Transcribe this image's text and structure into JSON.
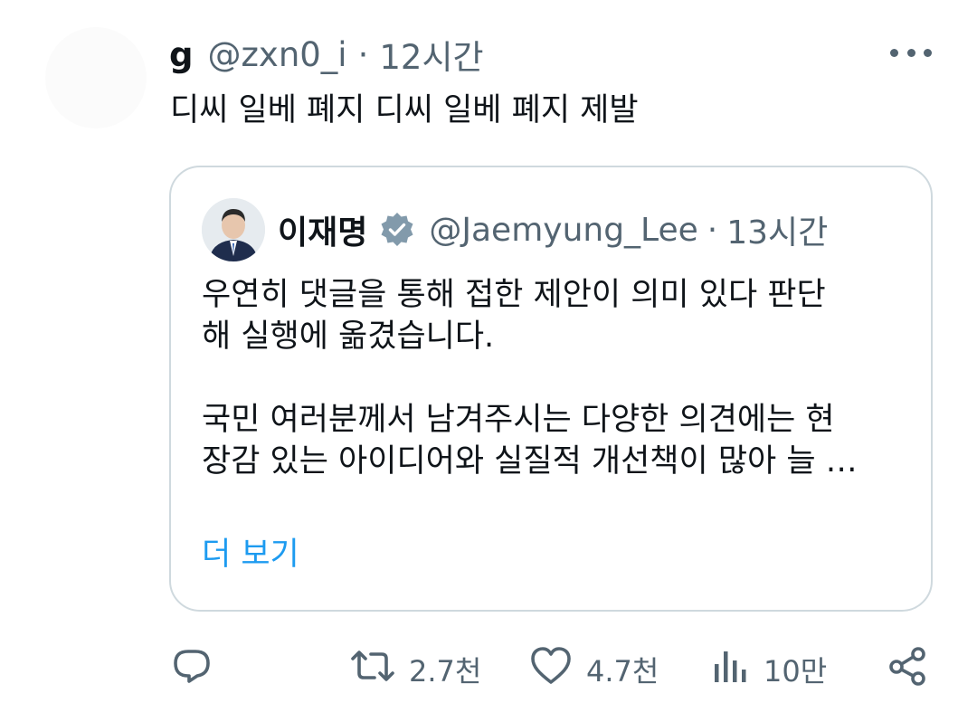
{
  "tweet": {
    "author_name": "g",
    "handle": "@zxn0_i",
    "separator": "·",
    "time": "12시간",
    "text": "디씨 일베 폐지 디씨 일베 폐지 제발"
  },
  "quote": {
    "author_name": "이재명",
    "verified": true,
    "handle": "@Jaemyung_Lee",
    "separator": "·",
    "time": "13시간",
    "lines": [
      "우연히 댓글을 통해 접한 제안이 의미 있다 판단",
      "해 실행에 옮겼습니다.",
      "국민 여러분께서 남겨주시는 다양한 의견에는 현",
      "장감 있는 아이디어와 실질적 개선책이 많아 늘 …"
    ],
    "show_more": "더 보기"
  },
  "actions": {
    "reply_count": "",
    "retweet_count": "2.7천",
    "like_count": "4.7천",
    "views_count": "10만"
  },
  "icons": {
    "more": "more-horizontal-icon",
    "verified": "verified-badge-icon",
    "reply": "reply-icon",
    "retweet": "retweet-icon",
    "like": "heart-icon",
    "views": "views-icon",
    "share": "share-icon"
  },
  "colors": {
    "text": "#0f1419",
    "muted": "#536471",
    "link": "#1d9bf0",
    "border": "#cfd9de",
    "verified": "#829aab"
  }
}
